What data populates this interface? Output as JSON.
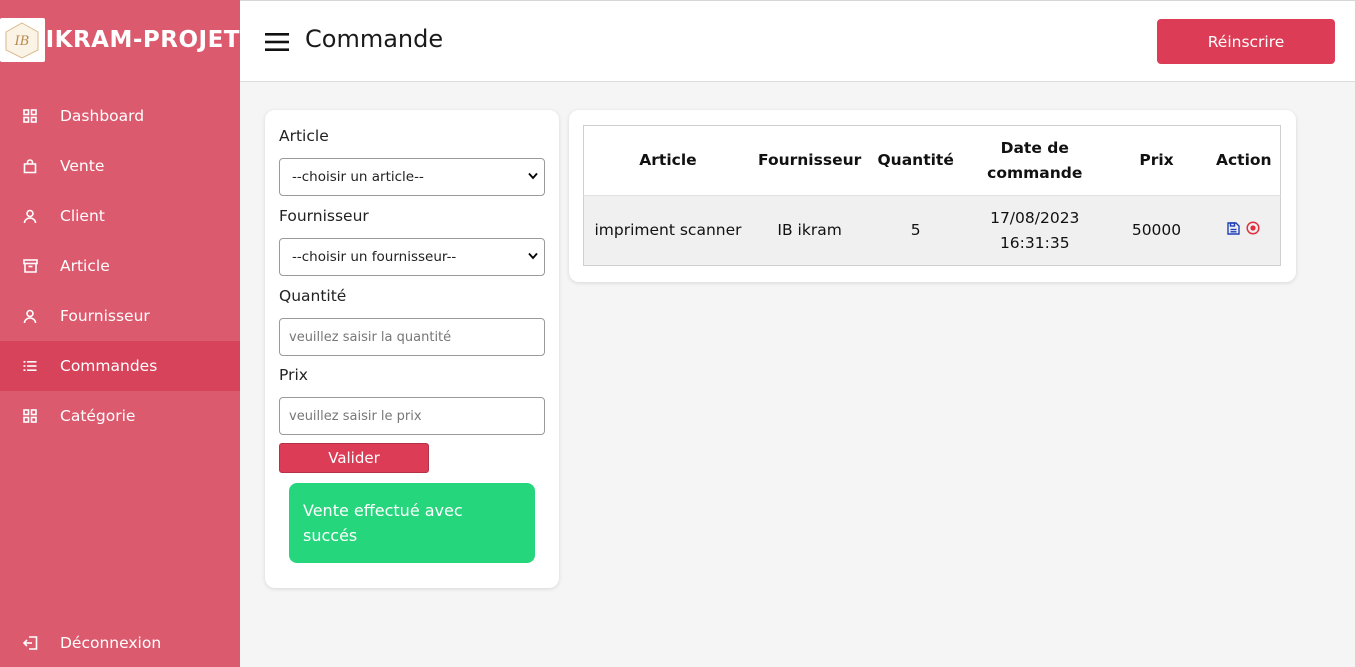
{
  "brand": {
    "name": "IKRAM-PROJET",
    "logo_text": "IB"
  },
  "sidebar": {
    "items": [
      {
        "label": "Dashboard",
        "icon": "grid-icon"
      },
      {
        "label": "Vente",
        "icon": "shopping-bag-icon"
      },
      {
        "label": "Client",
        "icon": "user-icon"
      },
      {
        "label": "Article",
        "icon": "archive-icon"
      },
      {
        "label": "Fournisseur",
        "icon": "user-icon"
      },
      {
        "label": "Commandes",
        "icon": "list-icon",
        "active": true
      },
      {
        "label": "Catégorie",
        "icon": "grid-icon"
      }
    ],
    "logout": {
      "label": "Déconnexion",
      "icon": "logout-icon"
    }
  },
  "header": {
    "title": "Commande",
    "reinscrire_label": "Réinscrire"
  },
  "form": {
    "article_label": "Article",
    "article_select": "--choisir un article--",
    "fournisseur_label": "Fournisseur",
    "fournisseur_select": "--choisir un fournisseur--",
    "quantite_label": "Quantité",
    "quantite_placeholder": "veuillez saisir la quantité",
    "prix_label": "Prix",
    "prix_placeholder": "veuillez saisir le prix",
    "valider_label": "Valider",
    "alert_text": "Vente effectué avec succés"
  },
  "table": {
    "headers": [
      "Article",
      "Fournisseur",
      "Quantité",
      "Date de commande",
      "Prix",
      "Action"
    ],
    "rows": [
      {
        "article": "impriment scanner",
        "fournisseur": "IB ikram",
        "quantite": "5",
        "date": "17/08/2023 16:31:35",
        "prix": "50000"
      }
    ]
  },
  "colors": {
    "sidebar": "#dc5a6e",
    "accent": "#dc3c55",
    "success": "#25d67c"
  }
}
